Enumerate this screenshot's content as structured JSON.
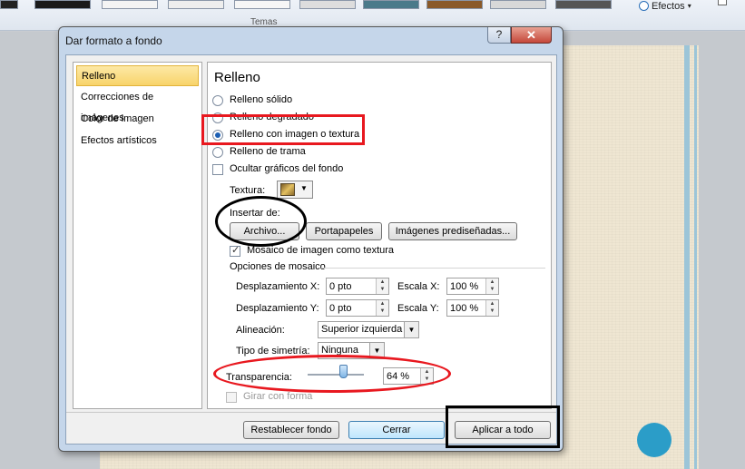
{
  "background": {
    "ribbon_group_label": "Temas",
    "effects_label": "Efectos",
    "accent_dot_color": "#2b9dc8",
    "stripe_color": "#9cc5d8"
  },
  "dialog": {
    "title": "Dar formato a fondo",
    "help_label": "?",
    "close_label": "✕",
    "nav": [
      {
        "label": "Relleno",
        "selected": true
      },
      {
        "label": "Correcciones de imágenes",
        "selected": false
      },
      {
        "label": "Color de imagen",
        "selected": false
      },
      {
        "label": "Efectos artísticos",
        "selected": false
      }
    ],
    "panel_title": "Relleno",
    "fill_options": [
      {
        "label": "Relleno sólido",
        "selected": false
      },
      {
        "label": "Relleno degradado",
        "selected": false
      },
      {
        "label": "Relleno con imagen o textura",
        "selected": true
      },
      {
        "label": "Relleno de trama",
        "selected": false
      }
    ],
    "hide_graphics_label": "Ocultar gráficos del fondo",
    "texture_label": "Textura:",
    "insert_from_label": "Insertar de:",
    "buttons": {
      "file": "Archivo...",
      "clipboard": "Portapapeles",
      "clipart": "Imágenes prediseñadas..."
    },
    "tile_checkbox_label": "Mosaico de imagen como textura",
    "tile_options_label": "Opciones de mosaico",
    "offset_x_label": "Desplazamiento X:",
    "offset_x_value": "0 pto",
    "offset_y_label": "Desplazamiento Y:",
    "offset_y_value": "0 pto",
    "scale_x_label": "Escala X:",
    "scale_x_value": "100 %",
    "scale_y_label": "Escala Y:",
    "scale_y_value": "100 %",
    "alignment_label": "Alineación:",
    "alignment_value": "Superior izquierda",
    "mirror_label": "Tipo de simetría:",
    "mirror_value": "Ninguna",
    "transparency_label": "Transparencia:",
    "transparency_value": "64 %",
    "transparency_level": 0.64,
    "rotate_label": "Girar con forma",
    "footer": {
      "reset": "Restablecer fondo",
      "close": "Cerrar",
      "apply_all": "Aplicar a todo"
    }
  }
}
